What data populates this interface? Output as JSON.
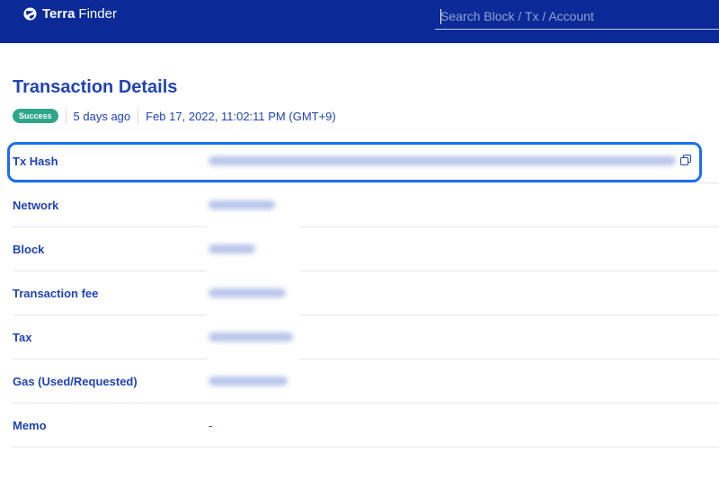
{
  "brand": {
    "name_bold": "Terra",
    "name_light": "Finder",
    "logo_icon": "terra-globe-icon"
  },
  "search": {
    "placeholder": "Search Block / Tx / Account"
  },
  "page": {
    "title": "Transaction Details"
  },
  "status": {
    "badge": "Success",
    "relative_time": "5 days ago",
    "timestamp": "Feb 17, 2022, 11:02:11 PM (GMT+9)"
  },
  "fields": [
    {
      "label": "Tx Hash",
      "value": "",
      "redacted": true
    },
    {
      "label": "Network",
      "value": "",
      "redacted": true
    },
    {
      "label": "Block",
      "value": "",
      "redacted": true
    },
    {
      "label": "Transaction fee",
      "value": "",
      "redacted": true
    },
    {
      "label": "Tax",
      "value": "",
      "redacted": true
    },
    {
      "label": "Gas (Used/Requested)",
      "value": "",
      "redacted": true
    },
    {
      "label": "Memo",
      "value": "-",
      "redacted": false
    }
  ],
  "icons": {
    "copy": "copy-icon"
  },
  "colors": {
    "header_bg": "#0b2a98",
    "accent_text": "#2043b5",
    "success_badge": "#2fa68a",
    "highlight_outline": "#1b6ef0"
  }
}
